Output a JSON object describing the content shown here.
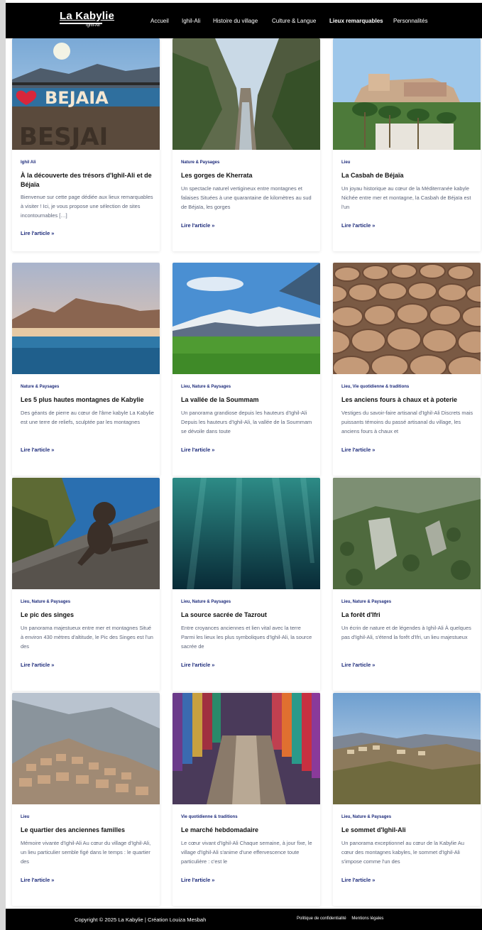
{
  "site": {
    "logo_title": "La Kabylie",
    "logo_sub": "Ighil-Ali"
  },
  "nav": {
    "items": [
      {
        "label": "Accueil"
      },
      {
        "label": "Ighil-Ali"
      },
      {
        "label": "Histoire du village"
      },
      {
        "label": "Culture & Langue"
      },
      {
        "label": "Lieux remarquables"
      },
      {
        "label": "Personnalités"
      }
    ]
  },
  "cards": [
    {
      "category": "Ighil Ali",
      "title": "À la découverte des trésors d'Ighil-Ali et de Béjaïa",
      "excerpt": "Bienvenue sur cette page dédiée aux lieux remarquables à visiter ! Ici, je vous propose une sélection de sites incontournables […]",
      "more": "Lire l'article »",
      "image": "bejaia-sign-photo"
    },
    {
      "category": "Nature & Paysages",
      "title": "Les gorges de Kherrata",
      "excerpt": "Un spectacle naturel vertigineux entre montagnes et falaises Situées à une quarantaine de kilomètres au sud de Béjaïa, les gorges",
      "more": "Lire l'article »",
      "image": "gorges-photo"
    },
    {
      "category": "Lieu",
      "title": "La Casbah de Béjaïa",
      "excerpt": "Un joyau historique au cœur de la Méditerranée kabyle Nichée entre mer et montagne, la Casbah de Béjaïa est l'un",
      "more": "Lire l'article »",
      "image": "casbah-photo"
    },
    {
      "category": "Nature & Paysages",
      "title": "Les 5 plus hautes montagnes de Kabylie",
      "excerpt": "Des géants de pierre au cœur de l'âme kabyle La Kabylie est une terre de reliefs, sculptée par les montagnes",
      "more": "Lire l'article »",
      "image": "mountains-sea-photo"
    },
    {
      "category": "Lieu, Nature & Paysages",
      "title": "La vallée de la Soummam",
      "excerpt": "Un panorama grandiose depuis les hauteurs d'Ighil-Ali Depuis les hauteurs d'Ighil-Ali, la vallée de la Soummam se dévoile dans toute",
      "more": "Lire l'article »",
      "image": "valley-photo"
    },
    {
      "category": "Lieu, Vie quotidienne & traditions",
      "title": "Les anciens fours à chaux et à poterie",
      "excerpt": "Vestiges du savoir-faire artisanal d'Ighil-Ali Discrets mais puissants témoins du passé artisanal du village, les anciens fours à chaux et",
      "more": "Lire l'article »",
      "image": "pottery-photo"
    },
    {
      "category": "Lieu, Nature & Paysages",
      "title": "Le pic des singes",
      "excerpt": "Un panorama majestueux entre mer et montagnes Situé à environ 430 mètres d'altitude, le Pic des Singes est l'un des",
      "more": "Lire l'article »",
      "image": "monkey-photo"
    },
    {
      "category": "Lieu, Nature & Paysages",
      "title": "La source sacrée de Tazrout",
      "excerpt": "Entre croyances anciennes et lien vital avec la terre Parmi les lieux les plus symboliques d'Ighil-Ali, la source sacrée de",
      "more": "Lire l'article »",
      "image": "underwater-photo"
    },
    {
      "category": "Lieu, Nature & Paysages",
      "title": "La forêt d'Ifri",
      "excerpt": "Un écrin de nature et de légendes à Ighil-Ali À quelques pas d'Ighil-Ali, s'étend la forêt d'Ifri, un lieu majestueux",
      "more": "Lire l'article »",
      "image": "forest-photo"
    },
    {
      "category": "Lieu",
      "title": "Le quartier des anciennes familles",
      "excerpt": "Mémoire vivante d'Ighil-Ali Au cœur du village d'Ighil-Ali, un lieu particulier semble figé dans le temps : le quartier des",
      "more": "Lire l'article »",
      "image": "village-photo"
    },
    {
      "category": "Vie quotidienne & traditions",
      "title": "Le marché hebdomadaire",
      "excerpt": "Le cœur vivant d'Ighil-Ali Chaque semaine, à jour fixe, le village d'Ighil-Ali s'anime d'une effervescence toute particulière : c'est le",
      "more": "Lire l'article »",
      "image": "market-photo"
    },
    {
      "category": "Lieu, Nature & Paysages",
      "title": "Le sommet d'Ighil-Ali",
      "excerpt": "Un panorama exceptionnel au cœur de la Kabylie Au cœur des montagnes kabyles, le sommet d'Ighil-Ali s'impose comme l'un des",
      "more": "Lire l'article »",
      "image": "summit-photo"
    }
  ],
  "footer": {
    "copyright": "Copyright © 2025 La Kabylie | Création Louiza Mesbah",
    "links": [
      "Politique de confidentialité",
      "Mentions légales"
    ]
  }
}
